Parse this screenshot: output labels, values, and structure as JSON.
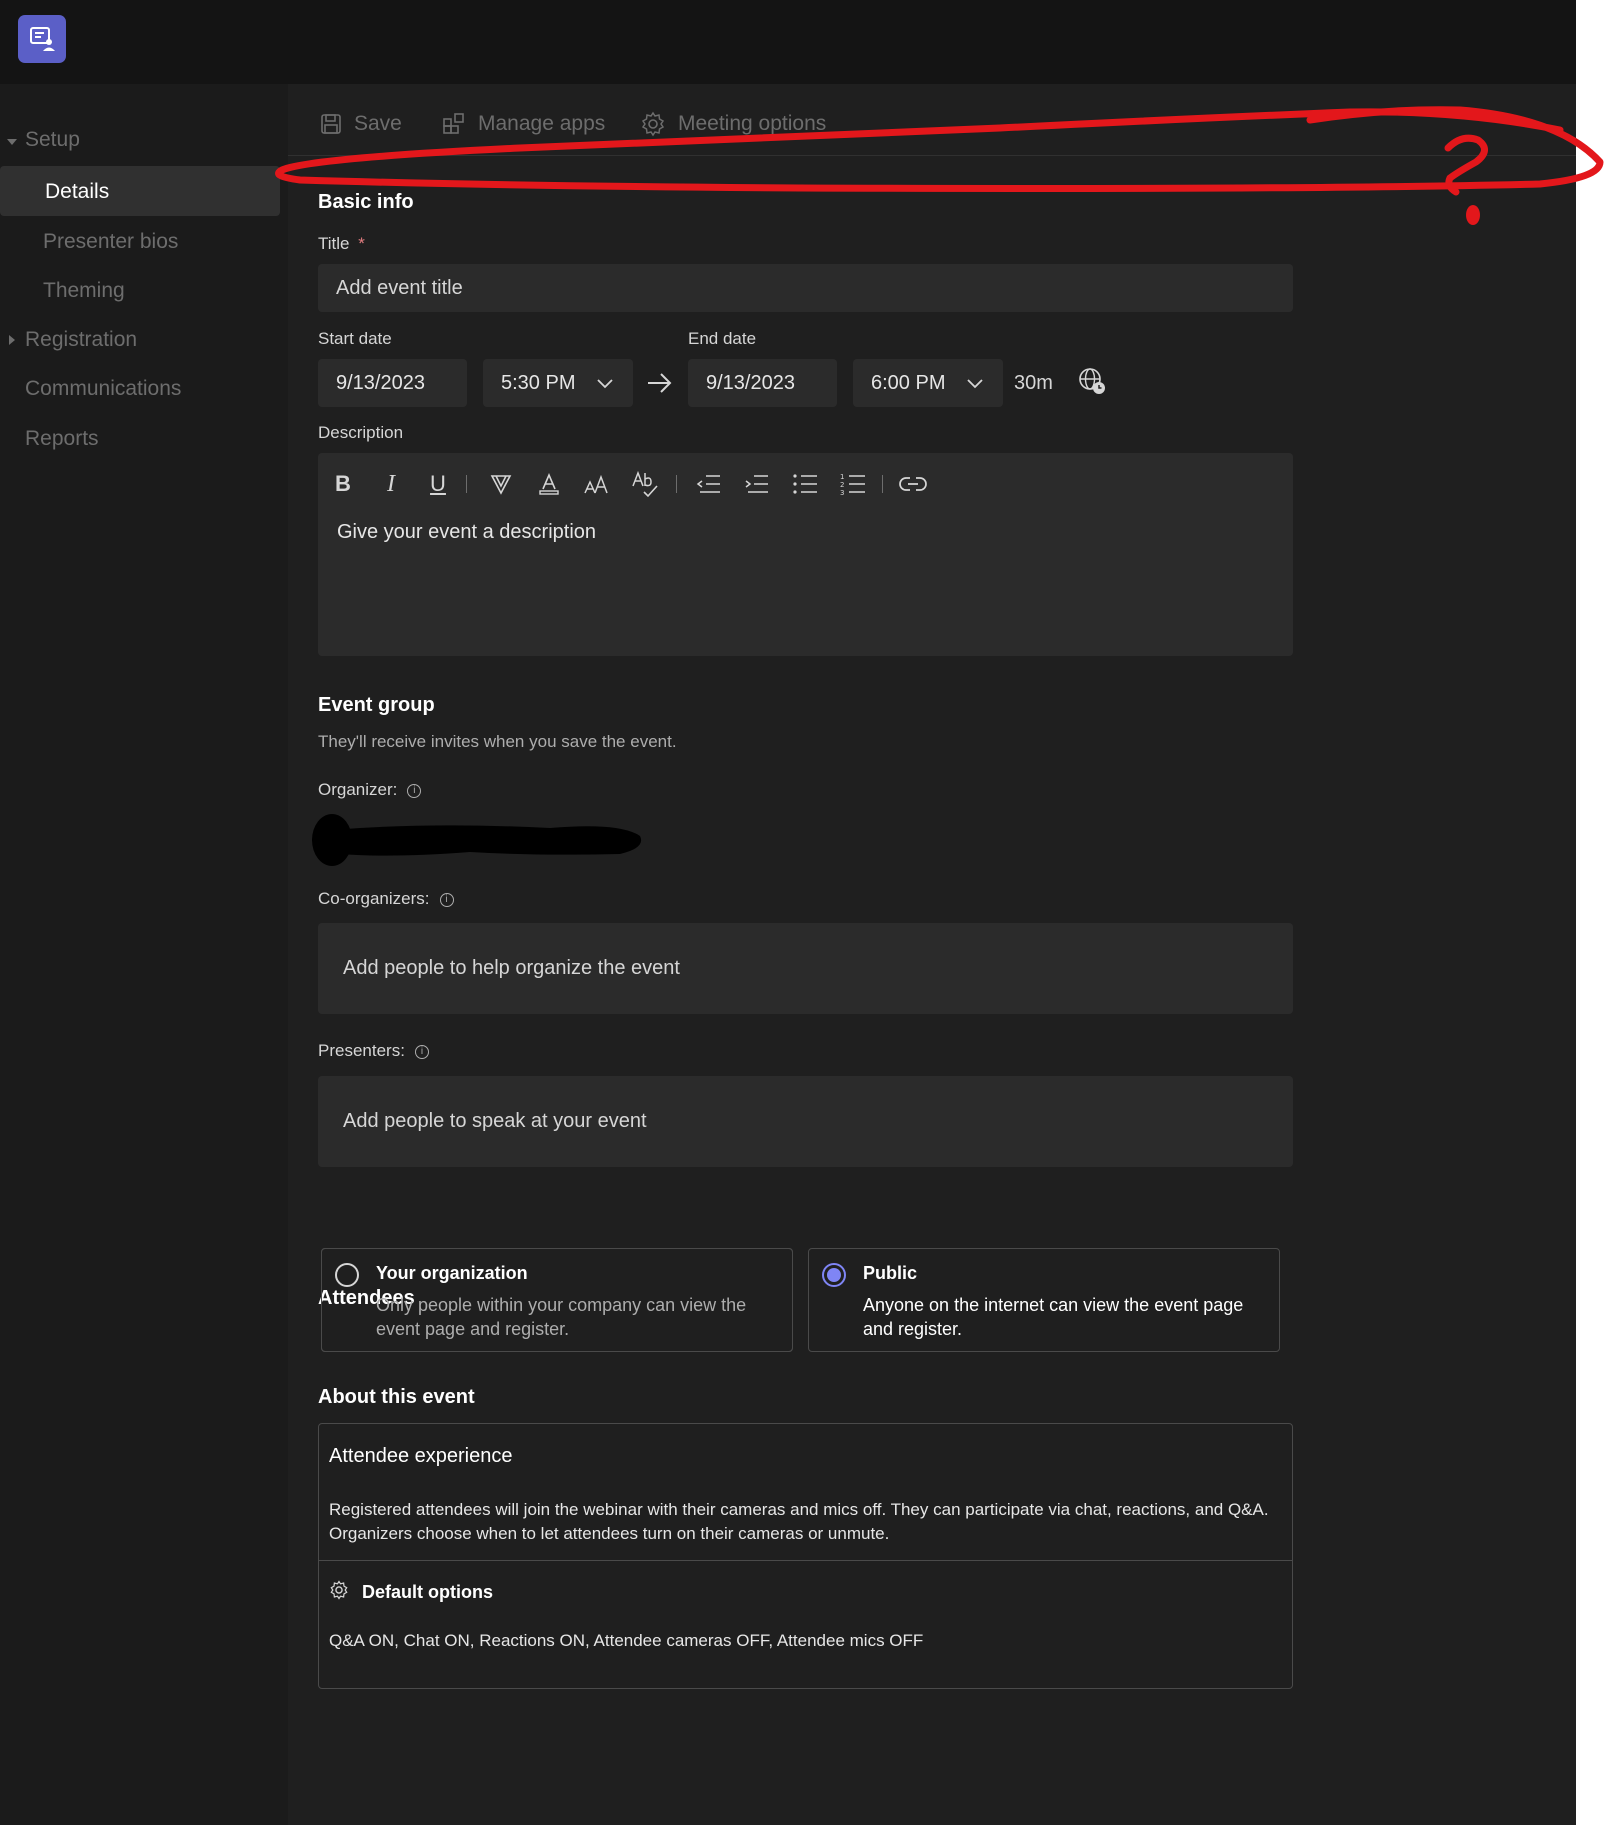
{
  "app": {
    "icon": "teams-webinar-icon"
  },
  "sidebar": {
    "setup": "Setup",
    "items": [
      {
        "label": "Details",
        "selected": true
      },
      {
        "label": "Presenter bios"
      },
      {
        "label": "Theming"
      }
    ],
    "registration": "Registration",
    "communications": "Communications",
    "reports": "Reports"
  },
  "toolbar": {
    "save": "Save",
    "manage_apps": "Manage apps",
    "meeting_options": "Meeting options"
  },
  "basic_info": {
    "heading": "Basic info",
    "title_label": "Title",
    "required_mark": "*",
    "title_placeholder": "Add event title",
    "start_date_label": "Start date",
    "end_date_label": "End date",
    "start_date": "9/13/2023",
    "start_time": "5:30 PM",
    "end_date": "9/13/2023",
    "end_time": "6:00 PM",
    "duration": "30m",
    "description_label": "Description",
    "description_placeholder": "Give your event a description"
  },
  "event_group": {
    "heading": "Event group",
    "subtitle": "They'll receive invites when you save the event.",
    "organizer_label": "Organizer:",
    "co_organizers_label": "Co-organizers:",
    "co_organizers_placeholder": "Add people to help organize the event",
    "presenters_label": "Presenters:",
    "presenters_placeholder": "Add people to speak at your event"
  },
  "attendees": {
    "heading": "Attendees",
    "options": [
      {
        "title": "Your organization",
        "desc": "Only people within your company can view the event page and register.",
        "selected": false
      },
      {
        "title": "Public",
        "desc": "Anyone on the internet can view the event page and register.",
        "selected": true
      }
    ]
  },
  "about": {
    "heading": "About this event",
    "experience_title": "Attendee experience",
    "experience_text": "Registered attendees will join the webinar with their cameras and mics off. They can participate via chat, reactions, and Q&A. Organizers choose when to let attendees turn on their cameras or unmute.",
    "default_options_title": "Default options",
    "default_options_text": "Q&A ON, Chat ON, Reactions ON, Attendee cameras OFF, Attendee mics OFF"
  },
  "colors": {
    "accent": "#5b5fc7",
    "radio_selected": "#7f85f5",
    "annotation": "#e3171b"
  }
}
